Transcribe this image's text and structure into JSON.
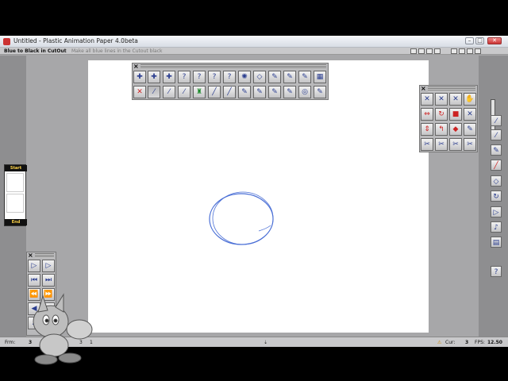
{
  "window": {
    "title": "Untitled - Plastic Animation Paper 4.0beta",
    "minimize_glyph": "–",
    "maximize_glyph": "□",
    "close_glyph": "✕"
  },
  "infobar": {
    "active_hint": "Blue to Black in CutOut",
    "hint": "Make all blue lines in the Cutout black"
  },
  "flipbook": {
    "start_label": "Start",
    "end_label": "End"
  },
  "statusbar": {
    "frame_label": "Frm:",
    "frame_value": "3",
    "value2": "1",
    "value3": "3",
    "value4": "1",
    "cur_label": "Cur:",
    "cur_value": "3",
    "fps_label": "FPS:",
    "fps_value": "12.50"
  },
  "palettes": {
    "top_left": {
      "row1": [
        "plus-pencil",
        "plus-pencil-2",
        "plus-pencil-3",
        "question-0",
        "question-1",
        "question-2",
        "question-3",
        "spinner",
        "eraser",
        "paint-1",
        "paint-2",
        "paint-3",
        "film-strip",
        "tape"
      ],
      "row1_labels": [
        "0",
        "",
        "0",
        "0",
        "1",
        "2",
        "3",
        "",
        "",
        "1",
        "2",
        "3",
        "",
        ""
      ],
      "row2_labels": [
        "",
        "",
        "",
        "",
        "",
        "",
        "",
        "",
        "",
        "+1",
        "+2",
        "+3",
        "",
        ""
      ]
    },
    "top_right": {},
    "playback": {}
  },
  "colors": {
    "canvas": "#ffffff",
    "app_bg": "#a7a7a9",
    "stroke_blue": "#4a6fd6",
    "accent": "#2a3d8f"
  },
  "drawing": {
    "shape": "circle",
    "stroke": "#4a6fd6"
  }
}
